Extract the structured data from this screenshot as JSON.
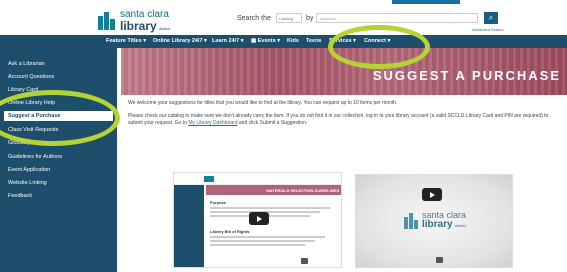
{
  "header": {
    "logo": {
      "line1": "santa clara",
      "line2": "library",
      "district": "district"
    },
    "search_label": "Search the",
    "search_scope": "Catalog",
    "by_label": "by",
    "search_field": "Keyword",
    "search_placeholder": "Keyword",
    "search_button_icon": "search-icon",
    "advanced_link": "Advanced Search"
  },
  "nav": {
    "items": [
      "Feature Titles ▾",
      "Online Library 24/7 ▾",
      "Learn 24/7 ▾",
      "▦ Events ▾",
      "Kids",
      "Teens",
      "Services ▾",
      "Connect ▾"
    ]
  },
  "sidebar": {
    "items": [
      "Ask a Librarian",
      "Account Questions",
      "Library Card",
      "Online Library Help",
      "Suggest a Purchase",
      "Class Visit Requests",
      "Glossary",
      "Guidelines for Authors",
      "Event Application",
      "Website Linking",
      "Feedback"
    ],
    "active_index": 4
  },
  "banner": {
    "title": "SUGGEST A PURCHASE"
  },
  "content": {
    "para1": "We welcome your suggestions for titles that you would like to find at the library. You can request up to 10 items per month.",
    "para2_a": "Please check our catalog to make sure we don't already carry the item. If you do not find it in our collection, log in to your library account (a valid SCCLD Library Card and PIN are required) to submit your request.  Go to ",
    "para2_link": "My Library Dashboard",
    "para2_b": " and click Submit a Suggestion."
  },
  "videos": {
    "video1": {
      "banner_text": "MATERIALS SELECTION GUIDELINES",
      "heading": "Purpose",
      "subheading": "Library Bill of Rights"
    },
    "video2": {
      "logo_line1": "santa clara",
      "logo_line2": "library",
      "logo_district": "district"
    }
  },
  "colors": {
    "nav": "#1d4e6b",
    "accent": "#b5d334",
    "banner": "#a7566a"
  }
}
